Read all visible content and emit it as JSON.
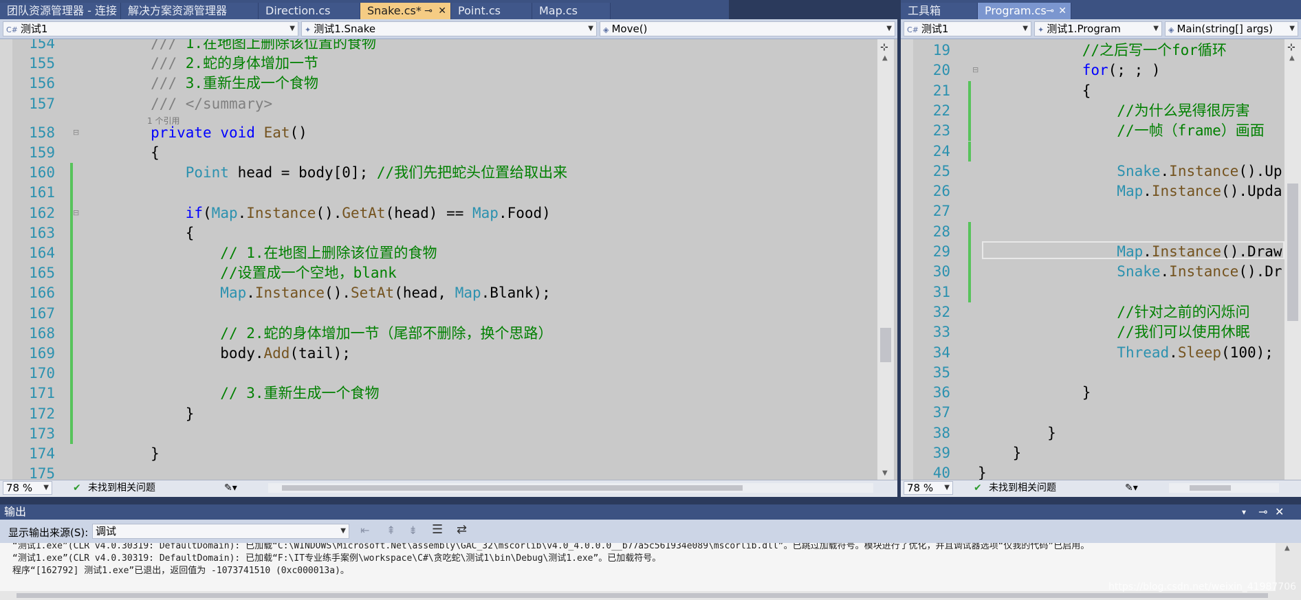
{
  "left_tabs": [
    "团队资源管理器 - 连接",
    "解决方案资源管理器",
    "Direction.cs",
    "Snake.cs*",
    "Point.cs",
    "Map.cs"
  ],
  "right_tabs": [
    "工具箱",
    "Program.cs"
  ],
  "left_nav": {
    "project": "测试1",
    "class": "测试1.Snake",
    "member": "Move()"
  },
  "right_nav": {
    "project": "测试1",
    "class": "测试1.Program",
    "member": "Main(string[] args)"
  },
  "left_code": [
    {
      "n": "154",
      "t": "        /// 1.在地图上删除该位置的食物"
    },
    {
      "n": "155",
      "t": "        /// 2.蛇的身体增加一节"
    },
    {
      "n": "156",
      "t": "        /// 3.重新生成一个食物"
    },
    {
      "n": "157",
      "t": "        /// </summary>"
    },
    {
      "n": "158",
      "t": "        private void Eat()"
    },
    {
      "n": "159",
      "t": "        {"
    },
    {
      "n": "160",
      "t": "            Point head = body[0]; //我们先把蛇头位置给取出来"
    },
    {
      "n": "161",
      "t": ""
    },
    {
      "n": "162",
      "t": "            if(Map.Instance().GetAt(head) == Map.Food)"
    },
    {
      "n": "163",
      "t": "            {"
    },
    {
      "n": "164",
      "t": "                // 1.在地图上删除该位置的食物"
    },
    {
      "n": "165",
      "t": "                //设置成一个空地，blank"
    },
    {
      "n": "166",
      "t": "                Map.Instance().SetAt(head, Map.Blank);"
    },
    {
      "n": "167",
      "t": ""
    },
    {
      "n": "168",
      "t": "                // 2.蛇的身体增加一节（尾部不删除，换个思路）"
    },
    {
      "n": "169",
      "t": "                body.Add(tail);"
    },
    {
      "n": "170",
      "t": ""
    },
    {
      "n": "171",
      "t": "                // 3.重新生成一个食物"
    },
    {
      "n": "172",
      "t": "            }"
    },
    {
      "n": "173",
      "t": ""
    },
    {
      "n": "174",
      "t": "        }"
    },
    {
      "n": "175",
      "t": ""
    }
  ],
  "ref_hint": "1 个引用",
  "right_code": [
    {
      "n": "19",
      "t": "            //之后写一个for循环"
    },
    {
      "n": "20",
      "t": "            for(; ; )"
    },
    {
      "n": "21",
      "t": "            {"
    },
    {
      "n": "22",
      "t": "                //为什么晃得很厉害"
    },
    {
      "n": "23",
      "t": "                //一帧（frame）画面"
    },
    {
      "n": "24",
      "t": ""
    },
    {
      "n": "25",
      "t": "                Snake.Instance().Up"
    },
    {
      "n": "26",
      "t": "                Map.Instance().Upda"
    },
    {
      "n": "27",
      "t": ""
    },
    {
      "n": "28",
      "t": ""
    },
    {
      "n": "29",
      "t": "                Map.Instance().Draw"
    },
    {
      "n": "30",
      "t": "                Snake.Instance().Dr"
    },
    {
      "n": "31",
      "t": ""
    },
    {
      "n": "32",
      "t": "                //针对之前的闪烁问"
    },
    {
      "n": "33",
      "t": "                //我们可以使用休眠"
    },
    {
      "n": "34",
      "t": "                Thread.Sleep(100);"
    },
    {
      "n": "35",
      "t": ""
    },
    {
      "n": "36",
      "t": "            }"
    },
    {
      "n": "37",
      "t": ""
    },
    {
      "n": "38",
      "t": "        }"
    },
    {
      "n": "39",
      "t": "    }"
    },
    {
      "n": "40",
      "t": "}"
    }
  ],
  "left_status": {
    "zoom": "78 %",
    "issues": "未找到相关问题"
  },
  "right_status": {
    "zoom": "78 %",
    "issues": "未找到相关问题"
  },
  "output": {
    "title": "输出",
    "source_label": "显示输出来源(S):",
    "source_value": "调试",
    "lines": [
      "“测试1.exe”(CLR v4.0.30319: DefaultDomain): 已加载“C:\\WINDOWS\\Microsoft.Net\\assembly\\GAC_32\\mscorlib\\v4.0_4.0.0.0__b77a5c561934e089\\mscorlib.dll”。已跳过加载符号。模块进行了优化，并且调试器选项“仅我的代码”已启用。",
      "“测试1.exe”(CLR v4.0.30319: DefaultDomain): 已加载“F:\\IT专业练手案例\\workspace\\C#\\贪吃蛇\\测试1\\bin\\Debug\\测试1.exe”。已加载符号。",
      "程序“[162792] 测试1.exe”已退出，返回值为 -1073741510 (0xc000013a)。"
    ]
  },
  "watermark": "https://blog.csdn.net/weixin_41987706"
}
